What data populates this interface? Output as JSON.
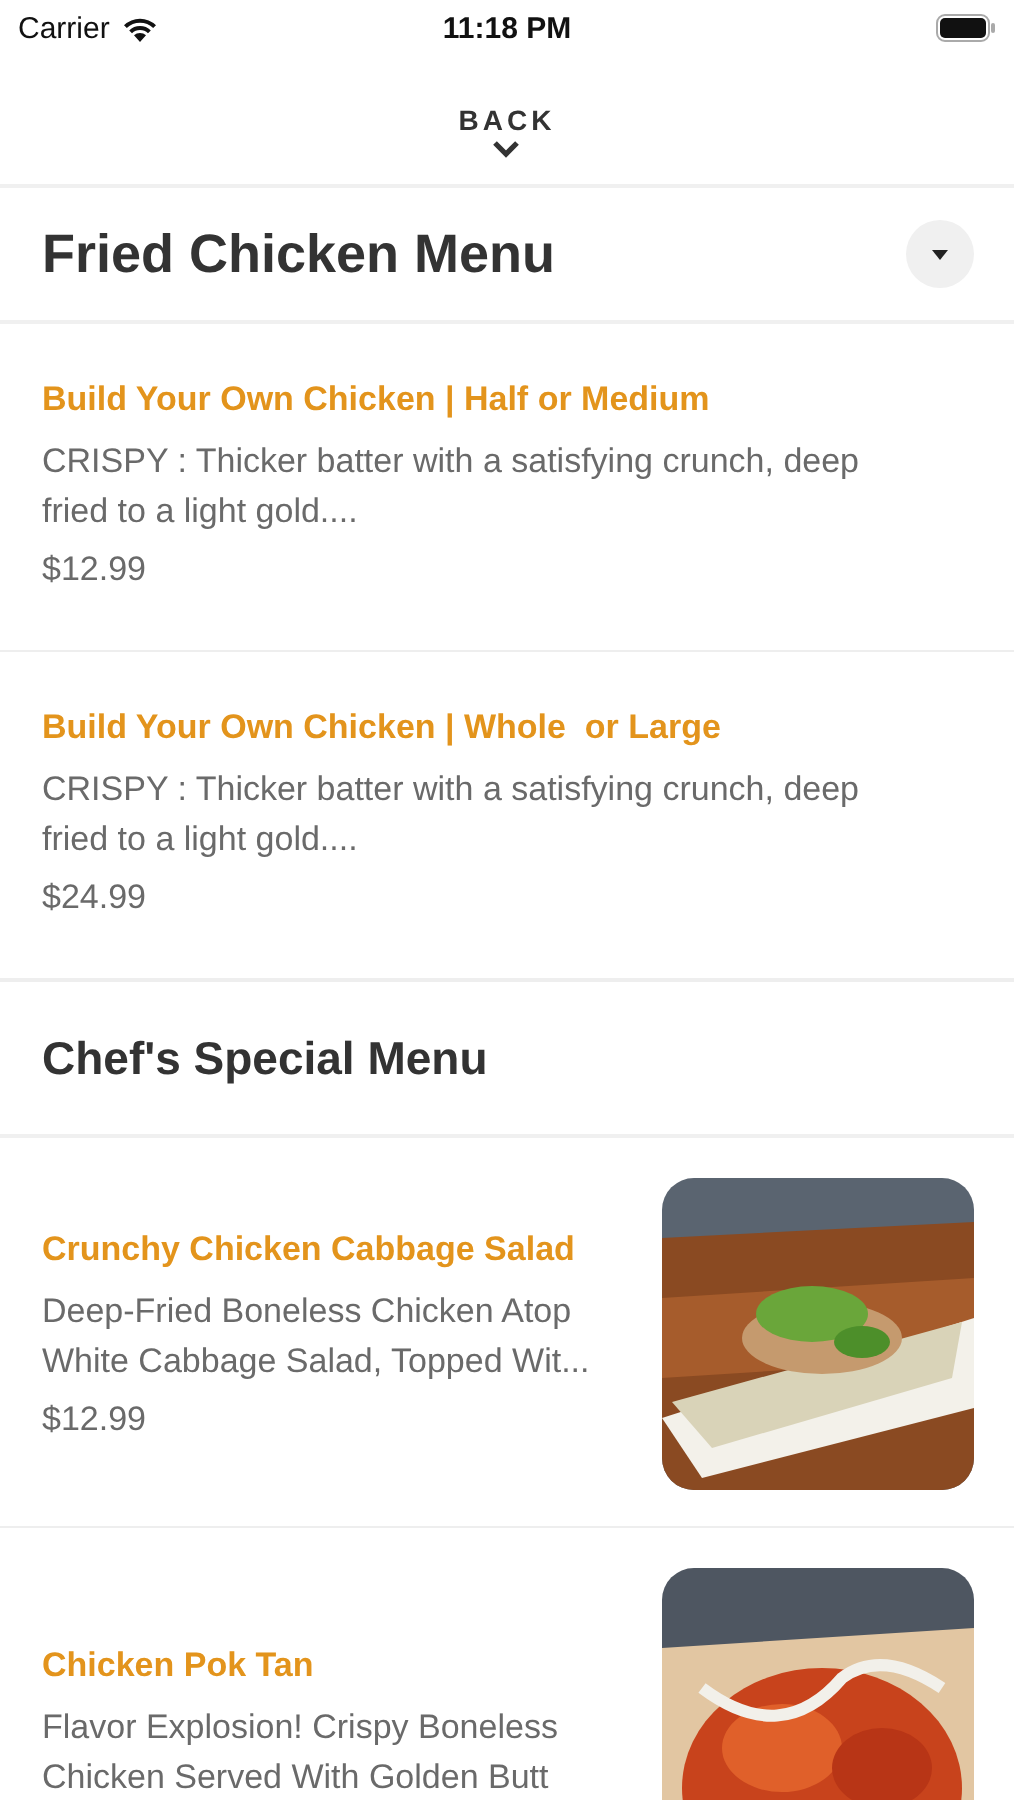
{
  "status_bar": {
    "carrier": "Carrier",
    "time": "11:18 PM"
  },
  "back": {
    "label": "BACK"
  },
  "sections": [
    {
      "title": "Fried Chicken Menu",
      "dropdown": true,
      "items": [
        {
          "name": "Build Your Own Chicken | Half or Medium",
          "description": "CRISPY : Thicker batter with a satisfying crunch, deep\nfried to a light gold....",
          "price": "$12.99"
        },
        {
          "name": "Build Your Own Chicken | Whole  or Large",
          "description": "CRISPY : Thicker batter with a satisfying crunch, deep\nfried to a light gold....",
          "price": "$24.99"
        }
      ]
    },
    {
      "title": "Chef's Special Menu",
      "items": [
        {
          "name": "Crunchy Chicken Cabbage Salad",
          "description": "Deep-Fried Boneless Chicken Atop\nWhite Cabbage Salad, Topped Wit...",
          "price": "$12.99"
        },
        {
          "name": "Chicken Pok Tan",
          "description": "Flavor Explosion! Crispy Boneless\nChicken Served With Golden Butt"
        }
      ]
    }
  ]
}
